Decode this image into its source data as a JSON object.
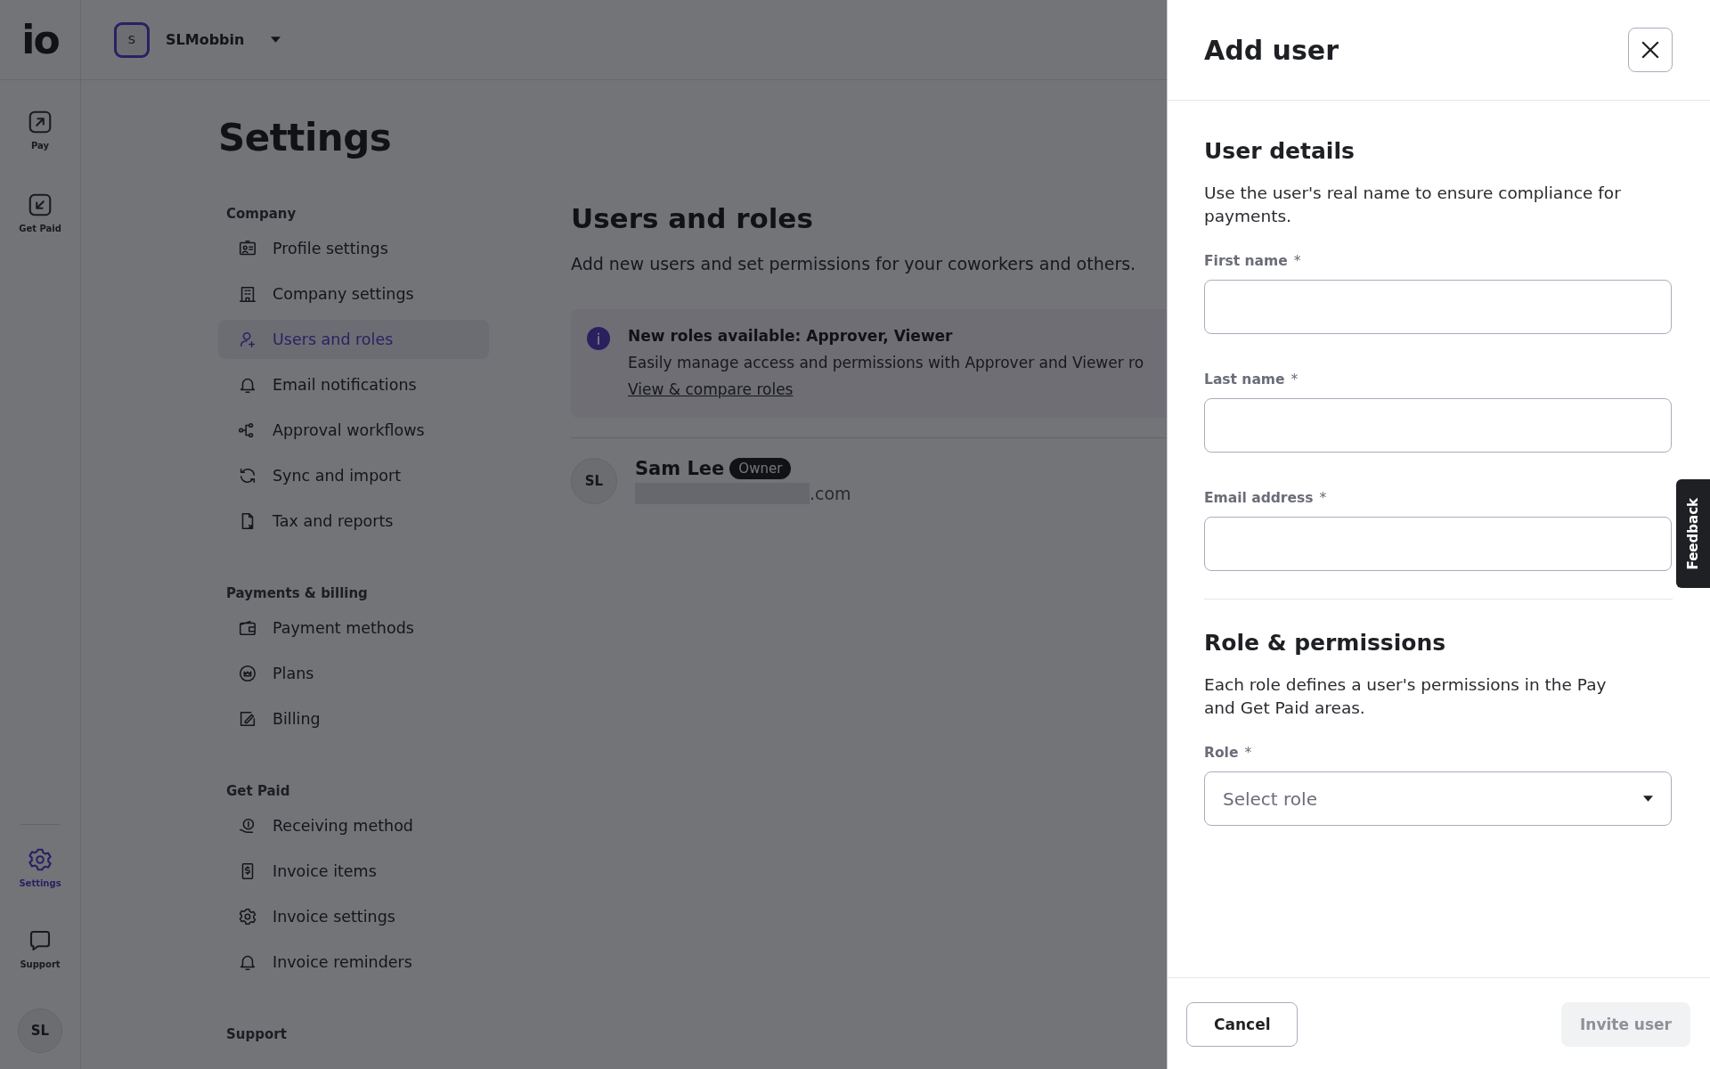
{
  "logo": "io",
  "workspace": {
    "initial": "S",
    "name": "SLMobbin"
  },
  "rail": {
    "items": [
      {
        "label": "Pay",
        "selected": false
      },
      {
        "label": "Get Paid",
        "selected": false
      },
      {
        "label": "Settings",
        "selected": true
      },
      {
        "label": "Support",
        "selected": false
      }
    ],
    "avatar": "SL"
  },
  "page_title": "Settings",
  "nav": {
    "sections": [
      {
        "heading": "Company",
        "items": [
          {
            "label": "Profile settings",
            "selected": false
          },
          {
            "label": "Company settings",
            "selected": false
          },
          {
            "label": "Users and roles",
            "selected": true
          },
          {
            "label": "Email notifications",
            "selected": false
          },
          {
            "label": "Approval workflows",
            "selected": false
          },
          {
            "label": "Sync and import",
            "selected": false
          },
          {
            "label": "Tax and reports",
            "selected": false
          }
        ]
      },
      {
        "heading": "Payments & billing",
        "items": [
          {
            "label": "Payment methods",
            "selected": false
          },
          {
            "label": "Plans",
            "selected": false
          },
          {
            "label": "Billing",
            "selected": false
          }
        ]
      },
      {
        "heading": "Get Paid",
        "items": [
          {
            "label": "Receiving method",
            "selected": false
          },
          {
            "label": "Invoice items",
            "selected": false
          },
          {
            "label": "Invoice settings",
            "selected": false
          },
          {
            "label": "Invoice reminders",
            "selected": false
          }
        ]
      },
      {
        "heading": "Support"
      }
    ]
  },
  "content": {
    "title": "Users and roles",
    "subtitle": "Add new users and set permissions for your coworkers and others.",
    "notice": {
      "title": "New roles available: Approver, Viewer",
      "text": "Easily manage access and permissions with Approver and Viewer ro",
      "link": "View & compare roles"
    },
    "users": [
      {
        "initials": "SL",
        "name": "Sam Lee",
        "badge": "Owner",
        "email": ".com"
      }
    ]
  },
  "panel": {
    "title": "Add user",
    "sections": [
      {
        "heading": "User details",
        "description": "Use the user's real name to ensure compliance for payments.",
        "fields": [
          {
            "kind": "text",
            "label": "First name",
            "mark": "*"
          },
          {
            "kind": "text",
            "label": "Last name",
            "mark": "*"
          },
          {
            "kind": "text",
            "label": "Email address",
            "mark": "*"
          }
        ]
      },
      {
        "heading": "Role & permissions",
        "description": "Each role defines a user's permissions in the Pay and Get Paid areas.",
        "fields": [
          {
            "kind": "select",
            "label": "Role",
            "mark": "*",
            "placeholder": "Select role"
          }
        ]
      }
    ],
    "buttons": [
      {
        "label": "Cancel",
        "disabled": false
      },
      {
        "label": "Invite user",
        "disabled": true
      }
    ]
  },
  "feedback_tab": "Feedback"
}
